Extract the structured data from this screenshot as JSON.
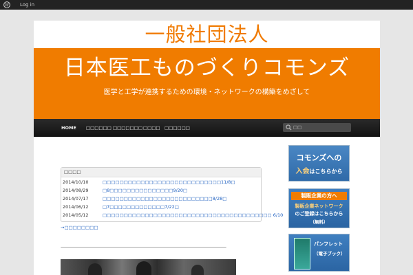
{
  "adminbar": {
    "login_label": "Log in"
  },
  "header": {
    "site_title": "一般社団法人",
    "banner_title": "日本医工ものづくりコモンズ",
    "banner_subtitle": "医学と工学が連携するための環境・ネットワークの構築をめざして"
  },
  "nav": {
    "items": [
      "HOME",
      "□□□□□□",
      "□□□□□□□",
      "□□□□",
      "□□□□□□"
    ],
    "search_placeholder": "□□"
  },
  "news": {
    "header": "□□□□",
    "rows": [
      {
        "date": "2014/10/10",
        "title": "□□□□□□□□□□□□□□□□□□□□□□□□□□□□11/8□"
      },
      {
        "date": "2014/08/29",
        "title": "□8□□□□□□□□□□□□□□□9/20□"
      },
      {
        "date": "2014/07/17",
        "title": "□□□□□□□□□□□□□□□□□□□□□□□□□□8/28□"
      },
      {
        "date": "2014/06/12",
        "title": "□7□□□□□□□□□□□□□7/22□"
      },
      {
        "date": "2014/05/12",
        "title": "□□□□□□□□□□□□□□□□□□□□□□□□□□□□□□□□□□□□□□□□ 6/10"
      }
    ],
    "more_link": "→□□□□□□□□"
  },
  "divider": "————————————————————————————————————————",
  "sidebar": {
    "join": {
      "line1": "コモンズへの",
      "line2_big": "入会",
      "line2_rest": "はこちらから"
    },
    "companies": {
      "header": "製販企業の方へ",
      "line1": "製販企業ネットワーク",
      "line2": "のご登録はこちらから",
      "line3": "（無料）"
    },
    "pamphlet": {
      "line1": "パンフレット",
      "line2": "（電子ブック）"
    }
  }
}
